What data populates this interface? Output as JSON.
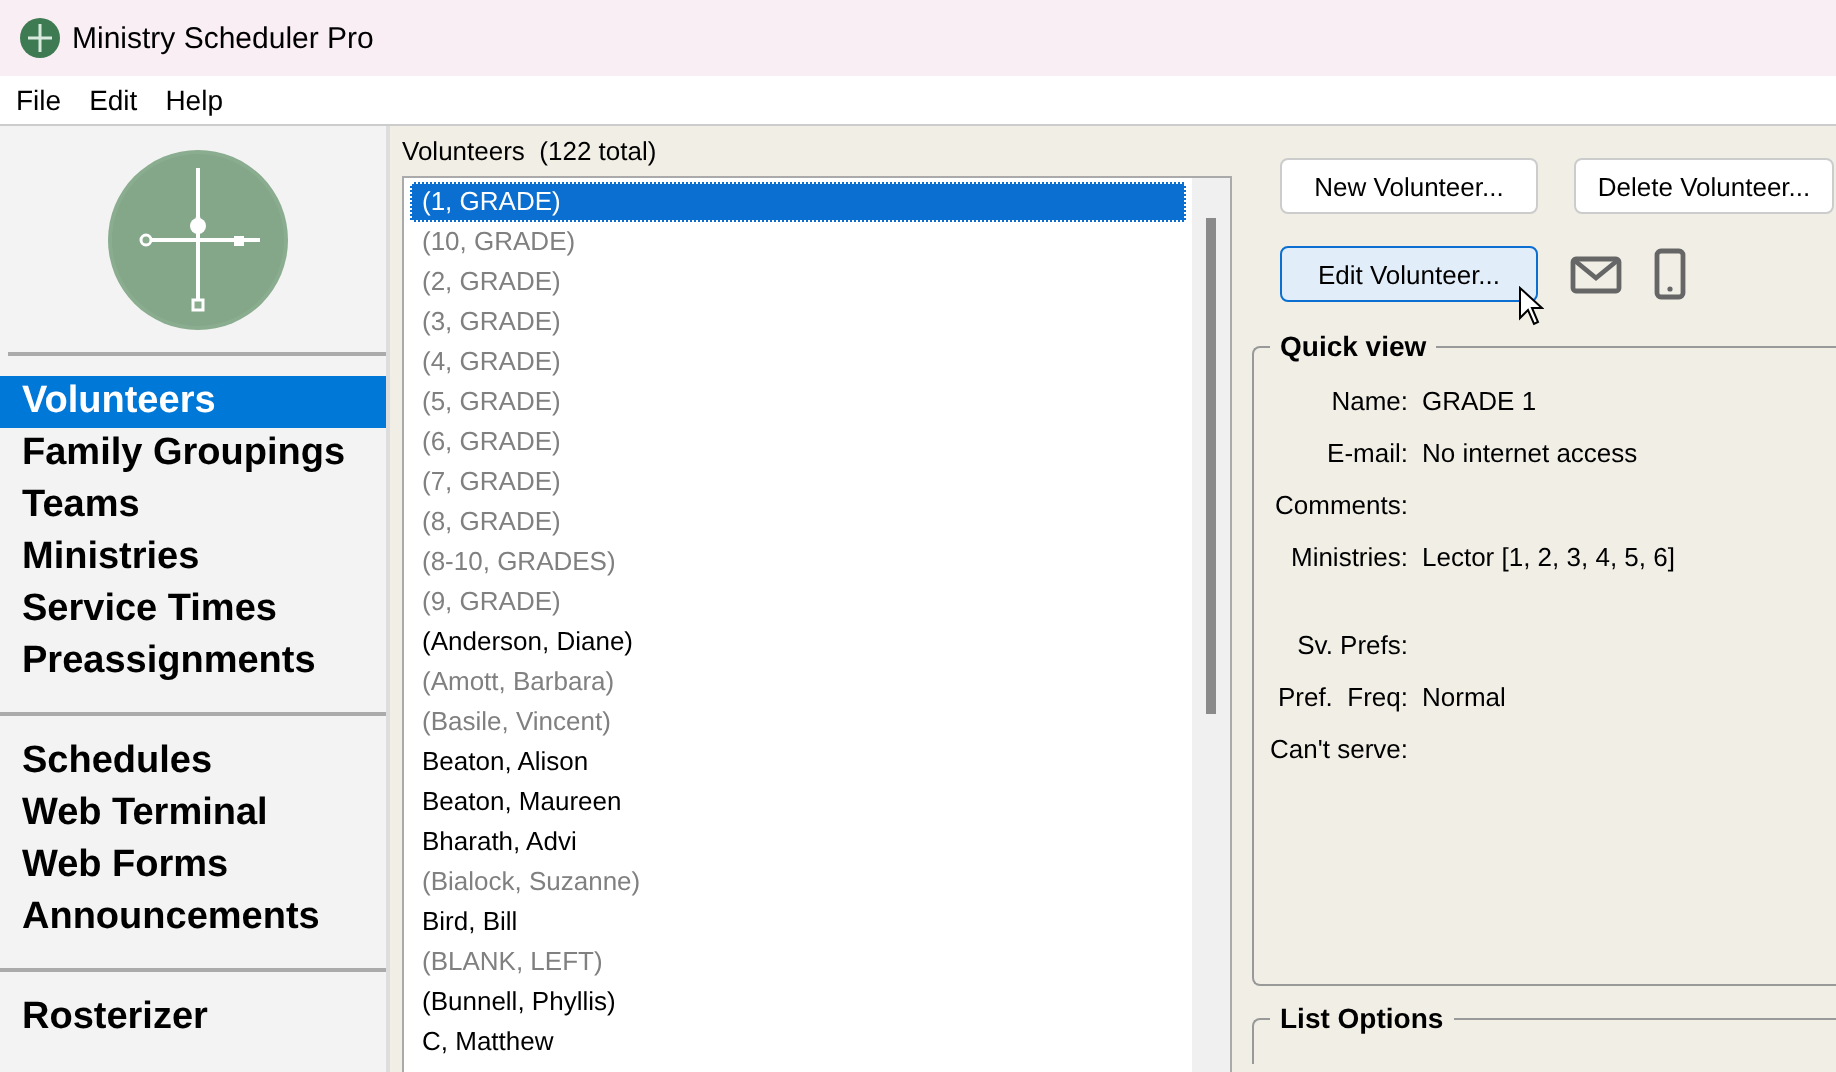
{
  "window": {
    "title": "Ministry Scheduler Pro"
  },
  "menu": [
    "File",
    "Edit",
    "Help"
  ],
  "sidebar": {
    "groups": [
      {
        "items": [
          {
            "label": "Volunteers",
            "selected": true
          },
          {
            "label": "Family Groupings",
            "selected": false
          },
          {
            "label": "Teams",
            "selected": false
          },
          {
            "label": "Ministries",
            "selected": false
          },
          {
            "label": "Service Times",
            "selected": false
          },
          {
            "label": "Preassignments",
            "selected": false
          }
        ]
      },
      {
        "items": [
          {
            "label": "Schedules",
            "selected": false
          },
          {
            "label": "Web Terminal",
            "selected": false
          },
          {
            "label": "Web Forms",
            "selected": false
          },
          {
            "label": "Announcements",
            "selected": false
          }
        ]
      },
      {
        "items": [
          {
            "label": "Rosterizer",
            "selected": false
          }
        ]
      }
    ]
  },
  "volunteers": {
    "heading": "Volunteers  (122 total)",
    "rows": [
      {
        "name": "(1, GRADE)",
        "selected": true,
        "inactive": false
      },
      {
        "name": "(10, GRADE)",
        "selected": false,
        "inactive": true
      },
      {
        "name": "(2, GRADE)",
        "selected": false,
        "inactive": true
      },
      {
        "name": "(3, GRADE)",
        "selected": false,
        "inactive": true
      },
      {
        "name": "(4, GRADE)",
        "selected": false,
        "inactive": true
      },
      {
        "name": "(5, GRADE)",
        "selected": false,
        "inactive": true
      },
      {
        "name": "(6, GRADE)",
        "selected": false,
        "inactive": true
      },
      {
        "name": "(7, GRADE)",
        "selected": false,
        "inactive": true
      },
      {
        "name": "(8, GRADE)",
        "selected": false,
        "inactive": true
      },
      {
        "name": "(8-10, GRADES)",
        "selected": false,
        "inactive": true
      },
      {
        "name": "(9, GRADE)",
        "selected": false,
        "inactive": true
      },
      {
        "name": "(Anderson, Diane)",
        "selected": false,
        "inactive": false
      },
      {
        "name": "(Amott, Barbara)",
        "selected": false,
        "inactive": true
      },
      {
        "name": "(Basile, Vincent)",
        "selected": false,
        "inactive": true
      },
      {
        "name": "Beaton, Alison",
        "selected": false,
        "inactive": false
      },
      {
        "name": "Beaton, Maureen",
        "selected": false,
        "inactive": false
      },
      {
        "name": "Bharath, Advi",
        "selected": false,
        "inactive": false
      },
      {
        "name": "(Bialock, Suzanne)",
        "selected": false,
        "inactive": true
      },
      {
        "name": "Bird, Bill",
        "selected": false,
        "inactive": false
      },
      {
        "name": "(BLANK, LEFT)",
        "selected": false,
        "inactive": true
      },
      {
        "name": "(Bunnell, Phyllis)",
        "selected": false,
        "inactive": false
      },
      {
        "name": "C, Matthew",
        "selected": false,
        "inactive": false
      }
    ]
  },
  "buttons": [
    {
      "label": "New Volunteer...",
      "focused": false
    },
    {
      "label": "Delete Volunteer...",
      "focused": false
    },
    {
      "label": "Edit Volunteer...",
      "focused": true
    }
  ],
  "quick_view": {
    "title": "Quick view",
    "fields": [
      {
        "label": "Name:",
        "value": "GRADE 1"
      },
      {
        "label": "E-mail:",
        "value": "No internet access"
      },
      {
        "label": "Comments:"
      },
      {
        "label": "Ministries:",
        "value": "Lector [1, 2, 3, 4, 5, 6]"
      },
      {
        "label": "Sv. Prefs:",
        "gap": true
      },
      {
        "label": "Pref.  Freq:",
        "value": "Normal"
      },
      {
        "label": "Can't serve:"
      }
    ]
  },
  "list_options": {
    "title": "List Options"
  }
}
